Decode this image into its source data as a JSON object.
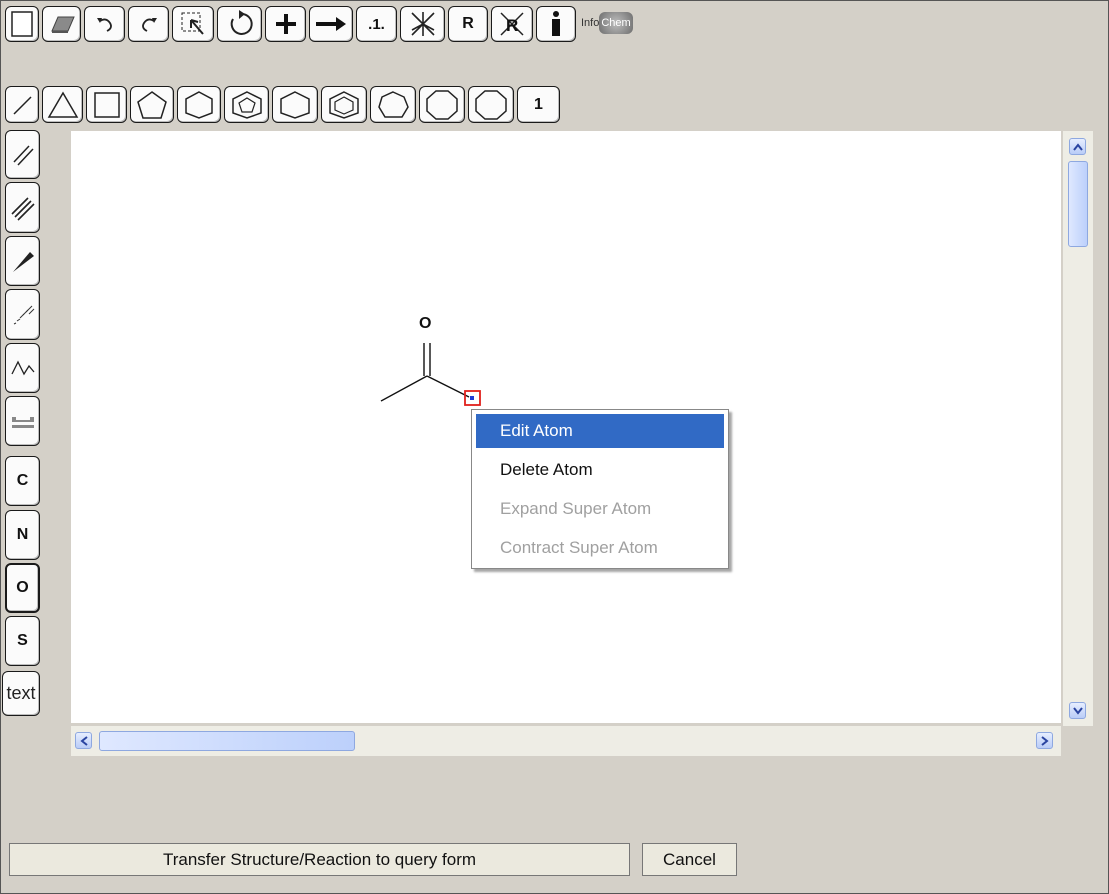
{
  "toolbar_top": {
    "new_icon": "new-page-icon",
    "eraser_icon": "eraser-icon",
    "undo_icon": "undo-icon",
    "redo_icon": "redo-icon",
    "lasso_icon": "lasso-select-icon",
    "rotate_icon": "rotate-icon",
    "plus_icon": "plus-icon",
    "arrow_icon": "reaction-arrow-icon",
    "numbering_label": ".1.",
    "clear_icon": "clear-atom-icon",
    "r_label": "R",
    "r_clear_icon": "clear-r-group-icon",
    "info_icon": "info-icon",
    "logo_text_1": "Info",
    "logo_text_2": "Chem"
  },
  "toolbar_rings": {
    "line_icon": "single-bond-icon",
    "triangle_icon": "cyclopropane-icon",
    "square_icon": "cyclobutane-icon",
    "pentagon_icon": "cyclopentane-icon",
    "hexagon_icon": "cyclohexane-icon",
    "furan_icon": "cyclopentadiene-icon",
    "hex2_icon": "cyclohexane-chair-icon",
    "benzene_icon": "benzene-icon",
    "heptagon_icon": "cycloheptane-icon",
    "octagon_icon": "cyclooctane-icon",
    "one_label": "1"
  },
  "toolbar_left": {
    "double_bond": "double-bond-icon",
    "triple_bond": "triple-bond-icon",
    "wedge_bond": "wedge-bond-icon",
    "hash_bond": "hash-bond-icon",
    "chain": "chain-icon",
    "template": "template-icon",
    "c_label": "C",
    "n_label": "N",
    "o_label": "O",
    "s_label": "S",
    "text_label": "text"
  },
  "molecule": {
    "atom_label": "O"
  },
  "context_menu": {
    "items": [
      {
        "label": "Edit Atom",
        "state": "selected"
      },
      {
        "label": "Delete Atom",
        "state": "enabled"
      },
      {
        "label": "Expand Super Atom",
        "state": "disabled"
      },
      {
        "label": "Contract Super Atom",
        "state": "disabled"
      }
    ]
  },
  "buttons": {
    "transfer": "Transfer Structure/Reaction to query form",
    "cancel": "Cancel"
  },
  "colors": {
    "menu_highlight": "#316ac5",
    "selection_box": "#e0201b",
    "atom_dot": "#1f3bd6"
  }
}
